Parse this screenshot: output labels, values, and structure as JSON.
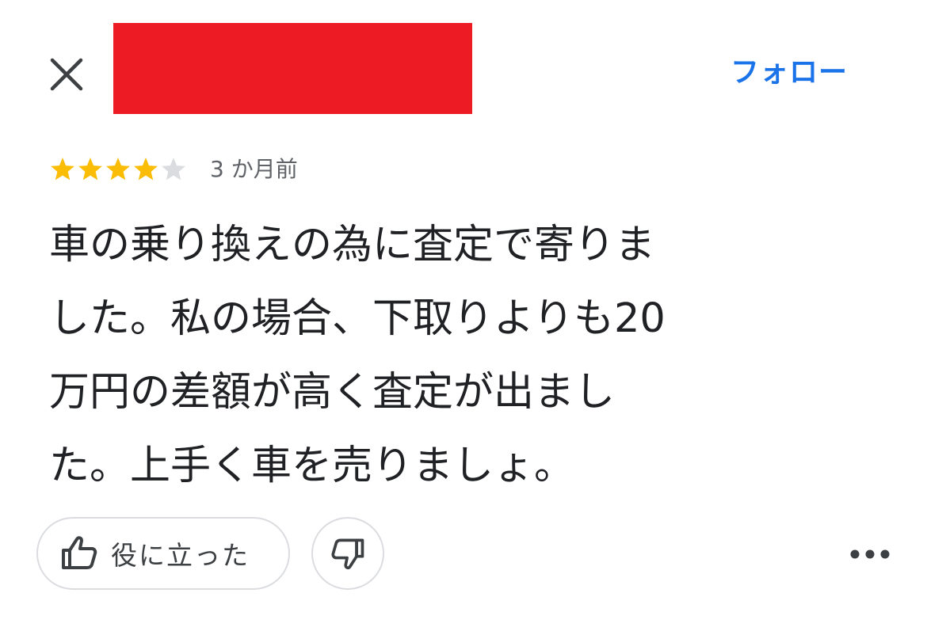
{
  "header": {
    "close_icon": "close-icon",
    "follow_label": "フォロー"
  },
  "colors": {
    "accent": "#1a73e8",
    "star_filled": "#fbbc04",
    "star_empty": "#dadce0",
    "redaction": "#ed1c24"
  },
  "review": {
    "rating": 4,
    "rating_max": 5,
    "time_ago": "3 か月前",
    "text": "車の乗り換えの為に査定で寄りま\nした。私の場合、下取りよりも20\n万円の差額が高く査定が出まし\nた。上手く車を売りましょ。"
  },
  "actions": {
    "helpful_label": "役に立った",
    "helpful_icon": "thumbs-up-icon",
    "not_helpful_icon": "thumbs-down-icon",
    "more_icon": "more-horiz-icon"
  }
}
